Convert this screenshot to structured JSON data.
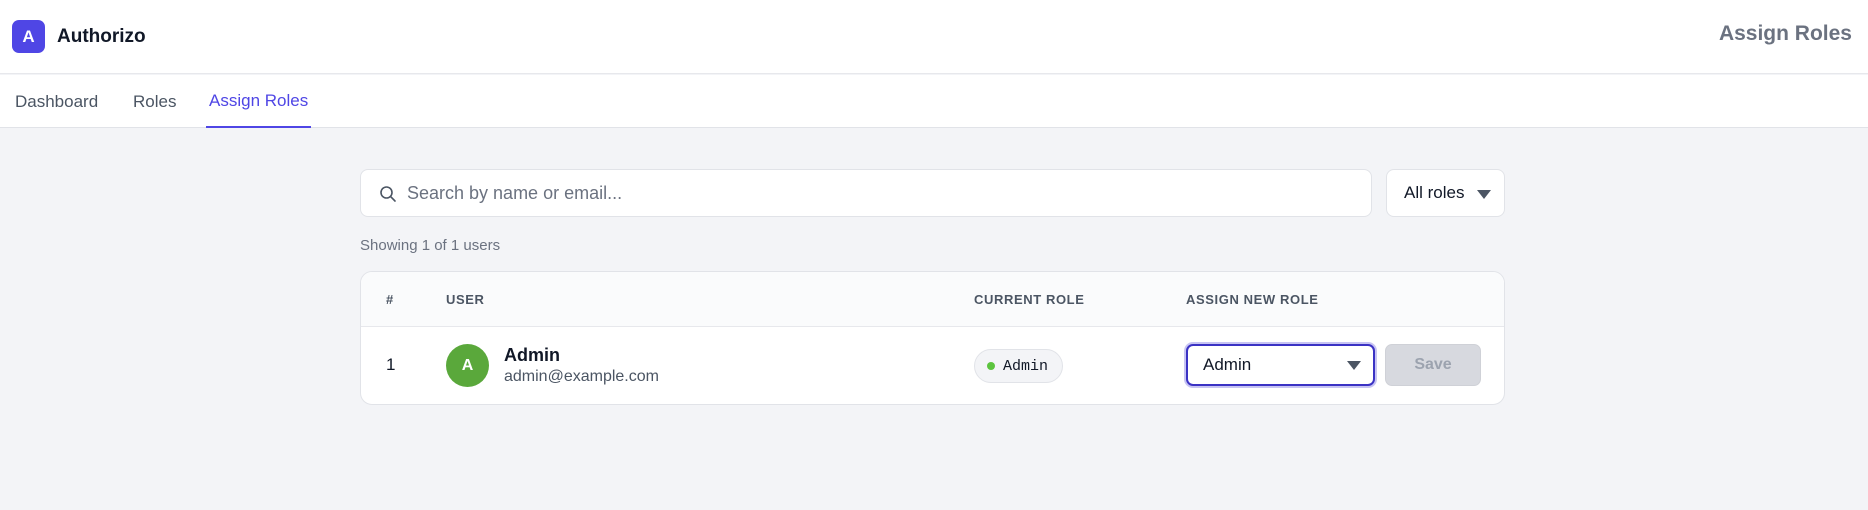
{
  "brand": {
    "logo_letter": "A",
    "name": "Authorizo"
  },
  "header": {
    "page_title": "Assign Roles"
  },
  "nav": {
    "tabs": [
      {
        "label": "Dashboard",
        "active": false
      },
      {
        "label": "Roles",
        "active": false
      },
      {
        "label": "Assign Roles",
        "active": true
      }
    ]
  },
  "search": {
    "placeholder": "Search by name or email...",
    "value": ""
  },
  "role_filter": {
    "selected": "All roles"
  },
  "summary": {
    "showing": "Showing 1 of 1 users"
  },
  "table": {
    "columns": [
      "#",
      "USER",
      "CURRENT ROLE",
      "ASSIGN NEW ROLE"
    ],
    "rows": [
      {
        "index": "1",
        "avatar_letter": "A",
        "name": "Admin",
        "email": "admin@example.com",
        "current_role": "Admin",
        "new_role": "Admin",
        "save_label": "Save"
      }
    ]
  },
  "colors": {
    "accent": "#4f46e5",
    "avatar": "#5aa83b",
    "status_dot": "#5cc43f",
    "disabled_button": "#d7d9df"
  },
  "icons": {
    "search": "search-icon",
    "dropdown": "chevron-down-icon",
    "status": "status-dot-icon"
  }
}
